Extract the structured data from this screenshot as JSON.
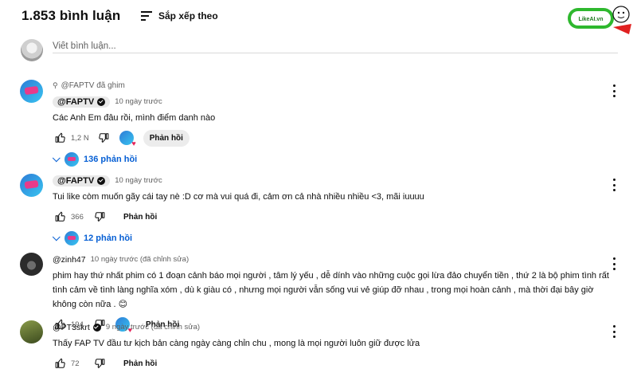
{
  "header": {
    "comment_count": "1.853 bình luận",
    "sort_label": "Sắp xếp theo"
  },
  "watermark": {
    "text": "LikeAI.vn"
  },
  "add_comment": {
    "placeholder": "Viết bình luận..."
  },
  "comments": [
    {
      "pinned_label": "@FAPTV đã ghim",
      "author": "@FAPTV",
      "time": "10 ngày trước",
      "text": "Các Anh Em đâu rồi, mình điểm danh nào",
      "likes": "1,2 N",
      "reply_label": "Phản hồi",
      "replies_label": "136 phản hồi"
    },
    {
      "author": "@FAPTV",
      "time": "10 ngày trước",
      "text": "Tui like còm muốn gãy cái tay nè :D cơ mà vui quá đi, cảm ơn cả nhà nhiều nhiều <3, mãi iuuuu",
      "likes": "366",
      "reply_label": "Phản hồi",
      "replies_label": "12 phản hồi"
    },
    {
      "author": "@zinh47",
      "time": "10 ngày trước (đã chỉnh sửa)",
      "text": "phim hay thứ nhất phim có 1 đoạn cảnh báo mọi người , tâm lý yếu , dễ dính vào những cuộc gọi lừa đảo chuyển tiền , thứ 2 là bộ phim tình rất tình cảm về tình làng nghĩa xóm , dù k giàu có , nhưng mọi người vẫn sống vui vẻ giúp đỡ nhau , trong mọi hoàn cảnh , mà thời đại bây giờ không còn nữa . 😊",
      "likes": "194",
      "reply_label": "Phản hồi"
    },
    {
      "author": "@PT3skrt",
      "time": "9 ngày trước (đã chỉnh sửa)",
      "text": "Thấy FAP TV đầu tư kịch bản càng ngày càng chỉn chu , mong là mọi người luôn giữ được lửa",
      "likes": "72",
      "reply_label": "Phản hồi"
    }
  ],
  "colors": {
    "link_blue": "#065fd4",
    "chip_gray": "#e9e9e9",
    "muted_text": "#606060",
    "watermark_green": "#2eb82e",
    "watermark_red": "#e02020"
  }
}
